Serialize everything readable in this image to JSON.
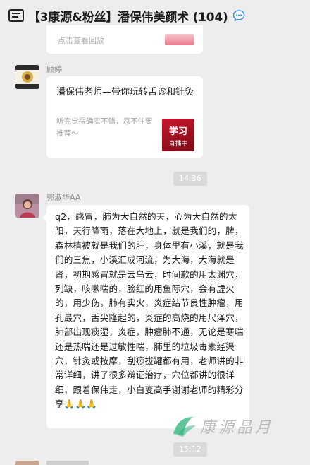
{
  "header": {
    "title": "【3康源&粉丝】潘保伟美颜术 (104)"
  },
  "card_partial": {
    "hint": "点击查看回放"
  },
  "messages": [
    {
      "sender": "顾婷",
      "card": {
        "title": "潘保伟老师—带你玩转舌诊和针灸",
        "desc": "听完觉得确实不错，忍不住要推荐～",
        "thumb_big": "学习",
        "thumb_small": "直播中"
      }
    },
    {
      "time": "14:36"
    },
    {
      "sender": "郭淑华AA",
      "text": "q2，感冒，肺为大自然的天，心为大自然的太阳，天行降雨，落在大地上，就是我们的，脾，森林植被就是我们的肝，身体里有小溪，就是我们的三焦，小溪汇成河流，为大海，大海就是肾，初期感冒就是云乌云，时间歉的用太渊穴，列缺，咳嗽喘的，脸红的用鱼际穴，会有虚火的，用少伤，肺有实火，炎症结节良性肿瘤，用孔最穴，舌尖隆起的，炎症的高烧的用尺泽穴，肺部出现痰湿，炎症，肿瘤肺不通，无论是寒喘还是热喘还是过敏性喘，肺里的垃圾毒素经渠穴，针灸或按摩，刮痧拔罐都有用，老师讲的非常详细，讲了很多辩证治疗，穴位都讲的很详细，跟着保伟走，小白变高手谢谢老师的精彩分享🙏🙏🙏"
    },
    {
      "time": "15:12"
    }
  ],
  "watermark": {
    "text": "康源晶月"
  },
  "colors": {
    "background": "#ededed",
    "bubble": "#ffffff",
    "time_pill": "#dadada",
    "watermark_green": "#2db37a"
  },
  "icons": [
    "chat-list-icon",
    "group-bubble-icon",
    "watermark-logo-icon"
  ]
}
